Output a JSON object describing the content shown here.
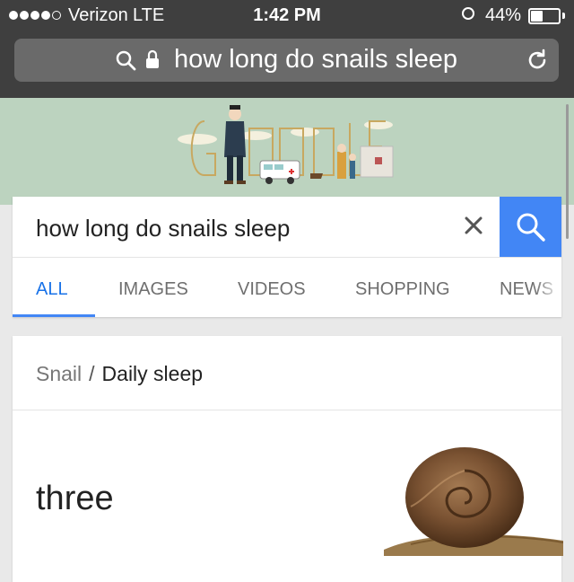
{
  "status_bar": {
    "carrier": "Verizon",
    "network": "LTE",
    "time": "1:42 PM",
    "battery_percent": "44%",
    "battery_level": 0.44,
    "signal_bars": 4,
    "signal_max": 5
  },
  "browser": {
    "url_text": "how long do snails sleep"
  },
  "search": {
    "query": "how long do snails sleep",
    "clear_label": "✕"
  },
  "tabs": [
    {
      "label": "ALL",
      "active": true
    },
    {
      "label": "IMAGES",
      "active": false
    },
    {
      "label": "VIDEOS",
      "active": false
    },
    {
      "label": "SHOPPING",
      "active": false
    },
    {
      "label": "NEWS",
      "active": false
    }
  ],
  "answer": {
    "breadcrumb": [
      "Snail",
      "Daily sleep"
    ],
    "breadcrumb_separator": "/",
    "value": "three"
  },
  "colors": {
    "accent": "#4286f5",
    "doodle_bg": "#bcd3bf",
    "chrome_bg": "#3f3f3f"
  }
}
